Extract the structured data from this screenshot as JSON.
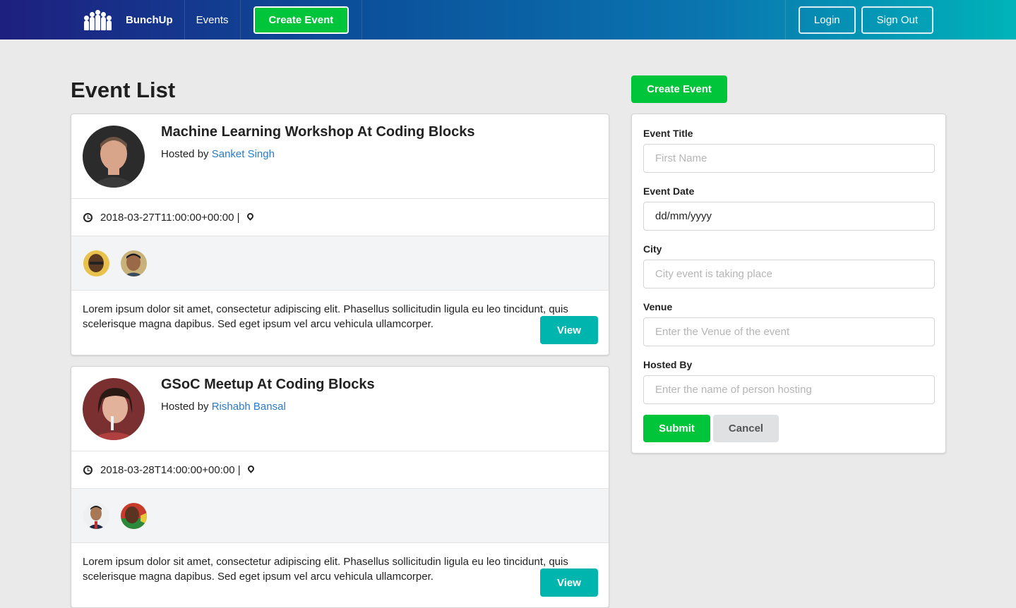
{
  "navbar": {
    "brand": "BunchUp",
    "events_link": "Events",
    "create_event_button": "Create Event",
    "login_button": "Login",
    "signout_button": "Sign Out"
  },
  "main": {
    "title": "Event List",
    "events": [
      {
        "title": "Machine Learning Workshop At Coding Blocks",
        "hosted_by_prefix": "Hosted by ",
        "host": "Sanket Singh",
        "datetime": "2018-03-27T11:00:00+00:00",
        "separator": " | ",
        "description": "Lorem ipsum dolor sit amet, consectetur adipiscing elit. Phasellus sollicitudin ligula eu leo tincidunt, quis scelerisque magna dapibus. Sed eget ipsum vel arcu vehicula ullamcorper.",
        "view_button": "View"
      },
      {
        "title": "GSoC Meetup At Coding Blocks",
        "hosted_by_prefix": "Hosted by ",
        "host": "Rishabh Bansal",
        "datetime": "2018-03-28T14:00:00+00:00",
        "separator": " | ",
        "description": "Lorem ipsum dolor sit amet, consectetur adipiscing elit. Phasellus sollicitudin ligula eu leo tincidunt, quis scelerisque magna dapibus. Sed eget ipsum vel arcu vehicula ullamcorper.",
        "view_button": "View"
      }
    ]
  },
  "sidebar": {
    "create_event_button": "Create Event",
    "form": {
      "event_title_label": "Event Title",
      "event_title_placeholder": "First Name",
      "event_date_label": "Event Date",
      "event_date_value": "dd/mm/yyyy",
      "city_label": "City",
      "city_placeholder": "City event is taking place",
      "venue_label": "Venue",
      "venue_placeholder": "Enter the Venue of the event",
      "hosted_by_label": "Hosted By",
      "hosted_by_placeholder": "Enter the name of person hosting",
      "submit_button": "Submit",
      "cancel_button": "Cancel"
    }
  },
  "colors": {
    "accent_green": "#00c43a",
    "teal": "#00b5ad",
    "link_blue": "#2a7ac9"
  }
}
